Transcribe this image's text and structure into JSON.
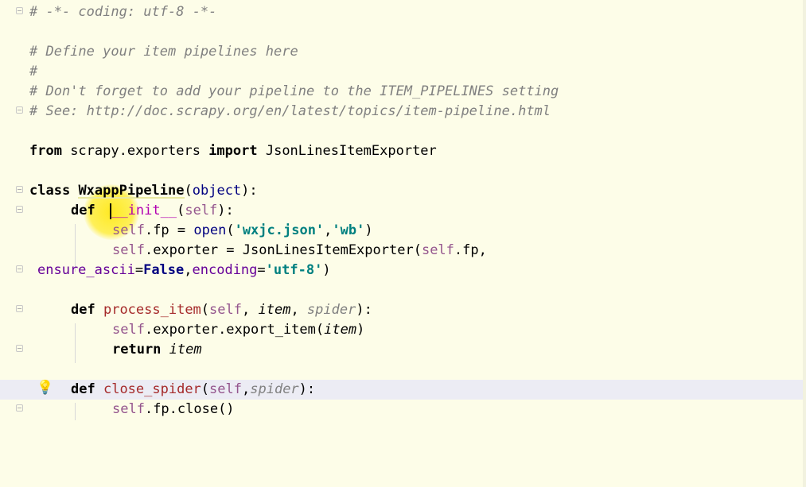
{
  "editor": {
    "language": "python",
    "lines": {
      "l1": "# -*- coding: utf-8 -*-",
      "l3": "# Define your item pipelines here",
      "l4": "#",
      "l5": "# Don't forget to add your pipeline to the ITEM_PIPELINES setting",
      "l6": "# See: http://doc.scrapy.org/en/latest/topics/item-pipeline.html",
      "l8": {
        "from": "from",
        "module": " scrapy.exporters ",
        "import": "import",
        "name": " JsonLinesItemExporter"
      },
      "l10": {
        "class": "class",
        "name": "WxappPipeline",
        "open": "(",
        "base": "object",
        "close": "):"
      },
      "l11": {
        "def": "def",
        "name": "__init__",
        "open": "(",
        "self": "self",
        "close": "):"
      },
      "l12": {
        "self": "self",
        "attr": ".fp = ",
        "open_fn": "open",
        "p1": "(",
        "s1": "'wxjc.json'",
        "comma": ",",
        "s2": "'wb'",
        "p2": ")"
      },
      "l13": {
        "self": "self",
        "attr": ".exporter = JsonLinesItemExporter(",
        "self2": "self",
        "rest": ".fp,"
      },
      "l14": {
        "k1": "ensure_ascii",
        "eq1": "=",
        "false": "False",
        "comma": ",",
        "k2": "encoding",
        "eq2": "=",
        "s": "'utf-8'",
        "close": ")"
      },
      "l16": {
        "def": "def",
        "name": "process_item",
        "open": "(",
        "self": "self",
        "c1": ", ",
        "item": "item",
        "c2": ", ",
        "spider": "spider",
        "close": "):"
      },
      "l17": {
        "self": "self",
        "call": ".exporter.export_item(",
        "item": "item",
        "close": ")"
      },
      "l18": {
        "ret": "return",
        "item": "item"
      },
      "l20": {
        "def": "def",
        "name": "close_spider",
        "open": "(",
        "self": "self",
        "comma": ",",
        "spider": "spider",
        "close": "):"
      },
      "l21": {
        "self": "self",
        "call": ".fp.close()"
      }
    }
  },
  "colors": {
    "background": "#fdfde8",
    "highlight_line": "#ececf4",
    "comment": "#808080",
    "keyword": "#000080",
    "string": "#008080",
    "self": "#94558d",
    "function_name": "#a52a2a"
  },
  "icons": {
    "fold": "fold-marker-icon",
    "bulb": "lightbulb-icon"
  }
}
